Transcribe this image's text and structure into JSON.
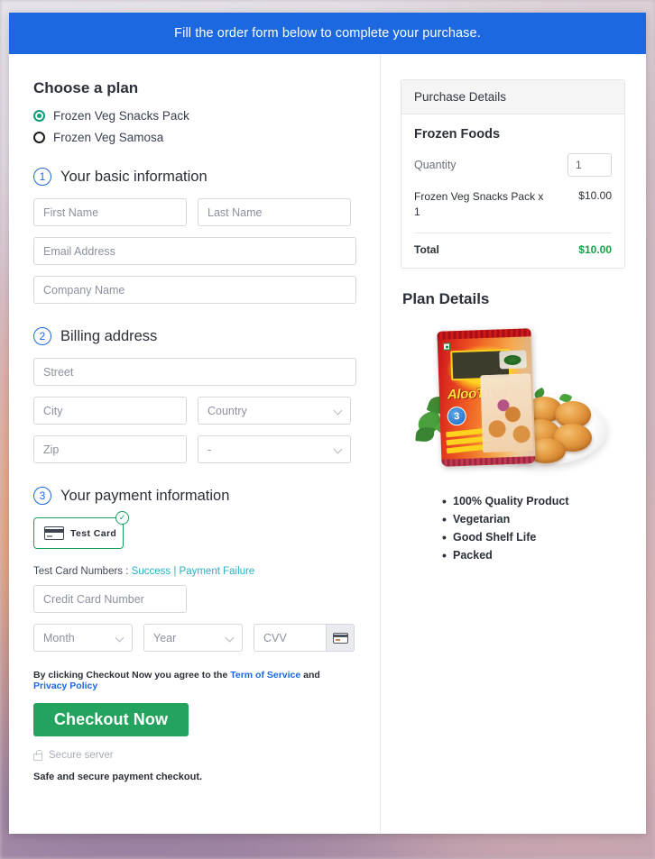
{
  "banner": {
    "text": "Fill the order form below to complete your purchase."
  },
  "plan": {
    "title": "Choose a plan",
    "options": [
      {
        "label": "Frozen Veg Snacks Pack",
        "selected": true
      },
      {
        "label": "Frozen Veg Samosa",
        "selected": false
      }
    ]
  },
  "basic_info": {
    "step": "1",
    "title": "Your basic information",
    "first_name_placeholder": "First Name",
    "last_name_placeholder": "Last Name",
    "email_placeholder": "Email Address",
    "company_placeholder": "Company Name"
  },
  "billing": {
    "step": "2",
    "title": "Billing address",
    "street_placeholder": "Street",
    "city_placeholder": "City",
    "country_value": "Country",
    "zip_placeholder": "Zip",
    "state_value": "-"
  },
  "payment": {
    "step": "3",
    "title": "Your payment information",
    "method_label": "Test Card",
    "method_badge": "✓",
    "test_numbers_label": "Test Card Numbers :",
    "success_link": "Success",
    "separator": "|",
    "failure_link": "Payment Failure",
    "card_number_placeholder": "Credit Card Number",
    "month_value": "Month",
    "year_value": "Year",
    "cvv_placeholder": "CVV"
  },
  "footer": {
    "terms_prefix": "By clicking Checkout Now you agree to the",
    "terms_link": "Term of Service",
    "terms_and": "and",
    "privacy_link": "Privacy Policy",
    "checkout_label": "Checkout Now",
    "secure_server": "Secure server",
    "safe_text": "Safe and secure payment checkout."
  },
  "purchase": {
    "header": "Purchase Details",
    "product_title": "Frozen Foods",
    "quantity_label": "Quantity",
    "quantity_value": "1",
    "line_item_name": "Frozen Veg Snacks Pack x 1",
    "line_item_amount": "$10.00",
    "total_label": "Total",
    "total_amount": "$10.00"
  },
  "plan_details": {
    "title": "Plan Details",
    "product_brand": "AlooTikki",
    "product_badge": "3",
    "features": [
      "100% Quality Product",
      "Vegetarian",
      "Good Shelf Life",
      "Packed"
    ]
  },
  "colors": {
    "banner_blue": "#1b68e0",
    "step_blue": "#1b68e0",
    "checkout_green": "#23a35d",
    "total_green": "#14a34a",
    "radio_green": "#0f9d7a",
    "tile_green": "#17a05a",
    "link_teal": "#29b0c4"
  }
}
